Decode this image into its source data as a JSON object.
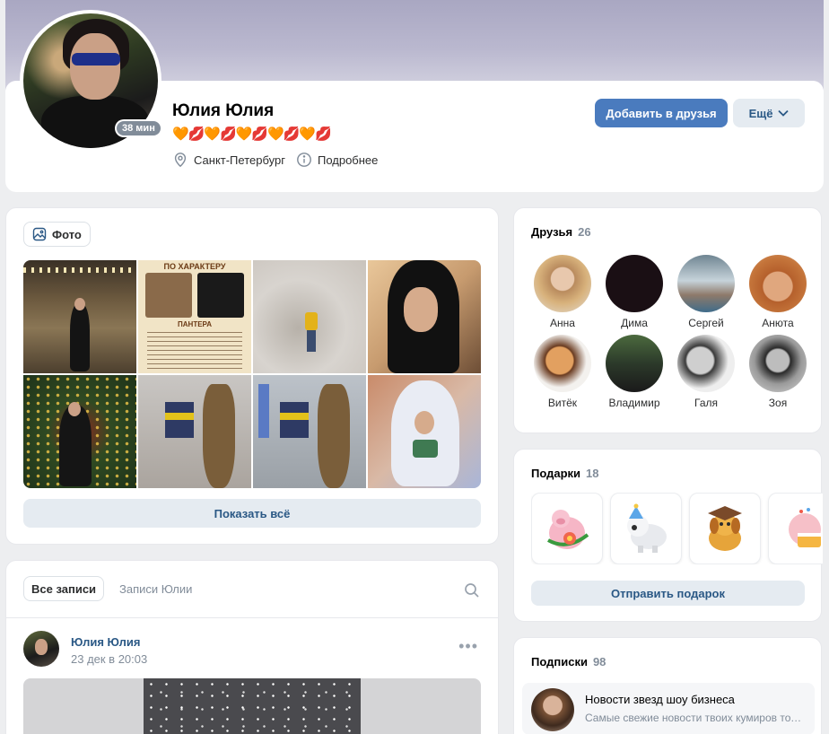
{
  "profile": {
    "name": "Юлия Юлия",
    "online_badge": "38 мин",
    "status": "🧡💋🧡💋🧡💋🧡💋🧡💋",
    "location": "Санкт-Петербург",
    "details_link": "Подробнее",
    "add_friend_label": "Добавить в друзья",
    "more_label": "Ещё"
  },
  "photos": {
    "chip_label": "Фото",
    "poster_title": "ПО ХАРАКТЕРУ",
    "poster_subtitle": "ПАНТЕРА",
    "show_all_label": "Показать всё"
  },
  "wall": {
    "tab_all": "Все записи",
    "tab_own": "Записи Юлии",
    "post": {
      "author": "Юлия Юлия",
      "date": "23 дек в 20:03"
    }
  },
  "friends": {
    "title": "Друзья",
    "count": "26",
    "items": [
      {
        "name": "Анна"
      },
      {
        "name": "Дима"
      },
      {
        "name": "Сергей"
      },
      {
        "name": "Анюта"
      },
      {
        "name": "Витёк"
      },
      {
        "name": "Владимир"
      },
      {
        "name": "Галя"
      },
      {
        "name": "Зоя"
      }
    ]
  },
  "gifts": {
    "title": "Подарки",
    "count": "18",
    "send_label": "Отправить подарок",
    "items": [
      "pig-with-flower",
      "white-dog-party-hat",
      "puppy-graduation-cap",
      "pig-with-cake"
    ]
  },
  "subscriptions": {
    "title": "Подписки",
    "count": "98",
    "items": [
      {
        "title": "Новости звезд шоу бизнеса",
        "description": "Самые свежие новости твоих кумиров только здесь"
      }
    ]
  },
  "colors": {
    "accent": "#4a7bbe",
    "link": "#2a5885",
    "secondary_text": "#818c99",
    "background": "#edeef0"
  }
}
